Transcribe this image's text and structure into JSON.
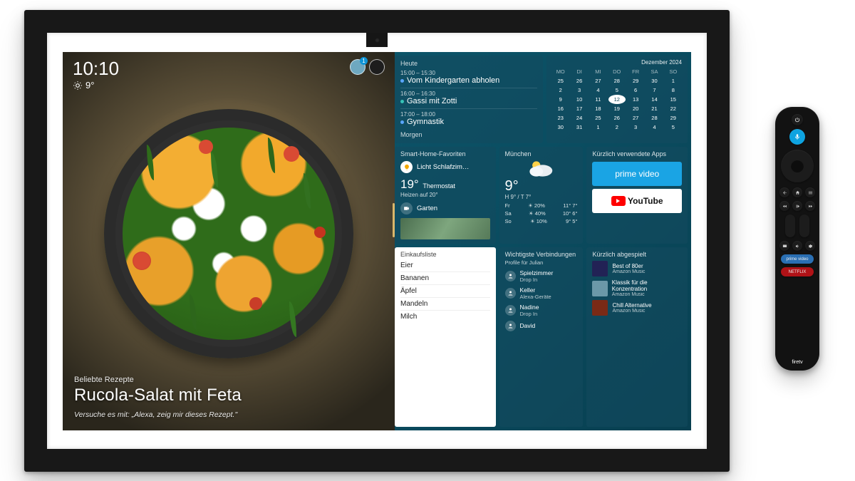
{
  "hero": {
    "clock": "10:10",
    "temp": "9°",
    "kicker": "Beliebte Rezepte",
    "title": "Rucola-Salat mit Feta",
    "hint": "Versuche es mit: „Alexa, zeig mir dieses Rezept.\""
  },
  "agenda": {
    "today_label": "Heute",
    "items": [
      {
        "time": "15:00 – 15:30",
        "text": "Vom Kindergarten abholen"
      },
      {
        "time": "16:00 – 16:30",
        "text": "Gassi mit Zotti"
      },
      {
        "time": "17:00 – 18:00",
        "text": "Gymnastik"
      }
    ],
    "tomorrow_label": "Morgen"
  },
  "calendar": {
    "month_label": "Dezember 2024",
    "dow": [
      "MO",
      "DI",
      "MI",
      "DO",
      "FR",
      "SA",
      "SO"
    ],
    "weeks": [
      [
        "25",
        "26",
        "27",
        "28",
        "29",
        "30",
        "1"
      ],
      [
        "2",
        "3",
        "4",
        "5",
        "6",
        "7",
        "8"
      ],
      [
        "9",
        "10",
        "11",
        "12",
        "13",
        "14",
        "15"
      ],
      [
        "16",
        "17",
        "18",
        "19",
        "20",
        "21",
        "22"
      ],
      [
        "23",
        "24",
        "25",
        "26",
        "27",
        "28",
        "29"
      ],
      [
        "30",
        "31",
        "1",
        "2",
        "3",
        "4",
        "5"
      ]
    ],
    "selected": "12"
  },
  "smarthome": {
    "title": "Smart-Home-Favoriten",
    "light_label": "Licht Schlafzim…",
    "thermo_value": "19°",
    "thermo_label": "Thermostat",
    "thermo_sub": "Heizen auf 20°",
    "garden_label": "Garten"
  },
  "weather": {
    "city": "München",
    "temp": "9°",
    "hilo": "H 9° / T 7°",
    "days": [
      {
        "d": "Fr",
        "r": "20%",
        "t": "11° 7°"
      },
      {
        "d": "Sa",
        "r": "40%",
        "t": "10° 6°"
      },
      {
        "d": "So",
        "r": "10%",
        "t": "9° 5°"
      }
    ]
  },
  "apps": {
    "title": "Kürzlich verwendete Apps",
    "prime": "prime video",
    "youtube": "YouTube"
  },
  "shopping": {
    "title": "Einkaufsliste",
    "items": [
      "Eier",
      "Bananen",
      "Äpfel",
      "Mandeln",
      "Milch"
    ]
  },
  "connections": {
    "title": "Wichtigste Verbindungen",
    "sub": "Profile für Julian",
    "items": [
      {
        "name": "Spielzimmer",
        "sub": "Drop In"
      },
      {
        "name": "Keller",
        "sub": "Alexa-Geräte"
      },
      {
        "name": "Nadine",
        "sub": "Drop In"
      },
      {
        "name": "David",
        "sub": ""
      }
    ]
  },
  "music": {
    "title": "Kürzlich abgespielt",
    "items": [
      {
        "name": "Best of 80er",
        "sub": "Amazon Music"
      },
      {
        "name": "Klassik für die Konzentration",
        "sub": "Amazon Music"
      },
      {
        "name": "Chill Alternative",
        "sub": "Amazon Music"
      }
    ]
  },
  "remote": {
    "brand": "firetv",
    "pill1": "prime video",
    "pill2": "NETFLIX"
  }
}
